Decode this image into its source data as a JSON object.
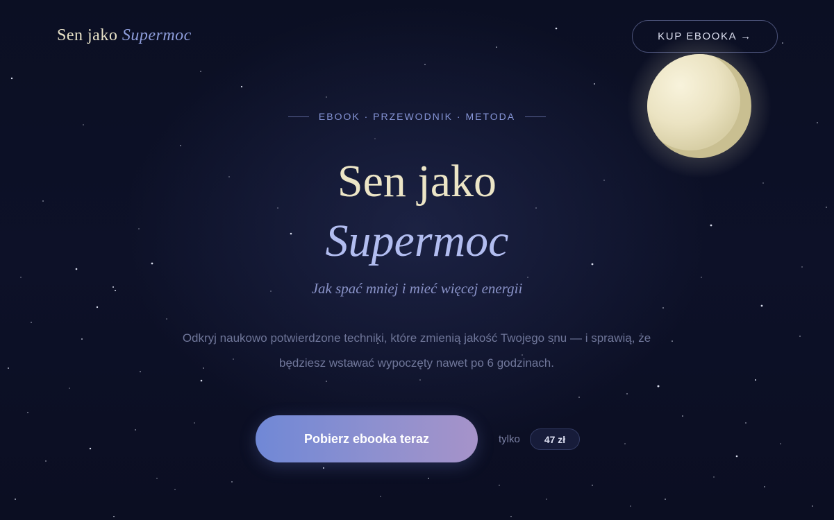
{
  "header": {
    "logo_main": "Sen jako",
    "logo_accent": "Supermoc",
    "buy_button_label": "KUP EBOOKA →"
  },
  "hero": {
    "eyebrow": "EBOOK · PRZEWODNIK · METODA",
    "title_line1": "Sen jako",
    "title_line2": "Supermoc",
    "tagline": "Jak spać mniej i mieć więcej energii",
    "description": "Odkryj naukowo potwierdzone techniki, które zmienią jakość Twojego snu — i sprawią, że będziesz wstawać wypoczęty nawet po 6 godzinach.",
    "cta_label": "Pobierz ebooka teraz",
    "price_prefix": "tylko",
    "price": "47 zł"
  },
  "decor": {
    "moon_icon": "moon-icon",
    "background": "starry-night-sky",
    "colors": {
      "background": "#0c1024",
      "cream": "#ece5c6",
      "accent": "#8f9edc",
      "cta_start": "#7088d6",
      "cta_end": "#a693c9"
    }
  }
}
